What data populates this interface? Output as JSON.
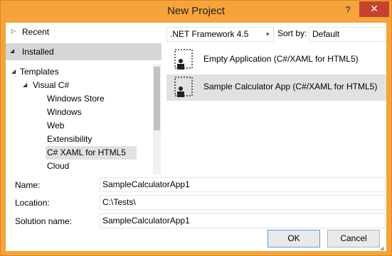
{
  "window": {
    "title": "New Project",
    "help_label": "?",
    "close_label": "✕"
  },
  "left_pane": {
    "recent": {
      "label": "Recent",
      "expander": "▷"
    },
    "installed": {
      "label": "Installed",
      "expander": "◢"
    },
    "tree": [
      {
        "label": "Templates",
        "expander": "◢"
      },
      {
        "label": "Visual C#",
        "expander": "◢"
      },
      {
        "label": "Windows Store"
      },
      {
        "label": "Windows"
      },
      {
        "label": "Web"
      },
      {
        "label": "Extensibility"
      },
      {
        "label": "C# XAML for HTML5",
        "selected": true
      },
      {
        "label": "Cloud"
      }
    ]
  },
  "toolbar": {
    "framework": ".NET Framework 4.5",
    "sort_label": "Sort by:",
    "sort_value": "Default"
  },
  "templates": [
    {
      "label": "Empty Application (C#/XAML for HTML5)",
      "icon": "template-icon"
    },
    {
      "label": "Sample Calculator App (C#/XAML for HTML5)",
      "icon": "template-icon",
      "selected": true
    }
  ],
  "form": {
    "name_label": "Name:",
    "name_value": "SampleCalculatorApp1",
    "location_label": "Location:",
    "location_value": "C:\\Tests\\",
    "solution_label": "Solution name:",
    "solution_value": "SampleCalculatorApp1"
  },
  "buttons": {
    "ok": "OK",
    "cancel": "Cancel"
  },
  "colors": {
    "title_bar": "#f5a33a",
    "close_button": "#c7422c",
    "selection": "#e1e1e1",
    "installed_bg": "#d6d6d6"
  }
}
